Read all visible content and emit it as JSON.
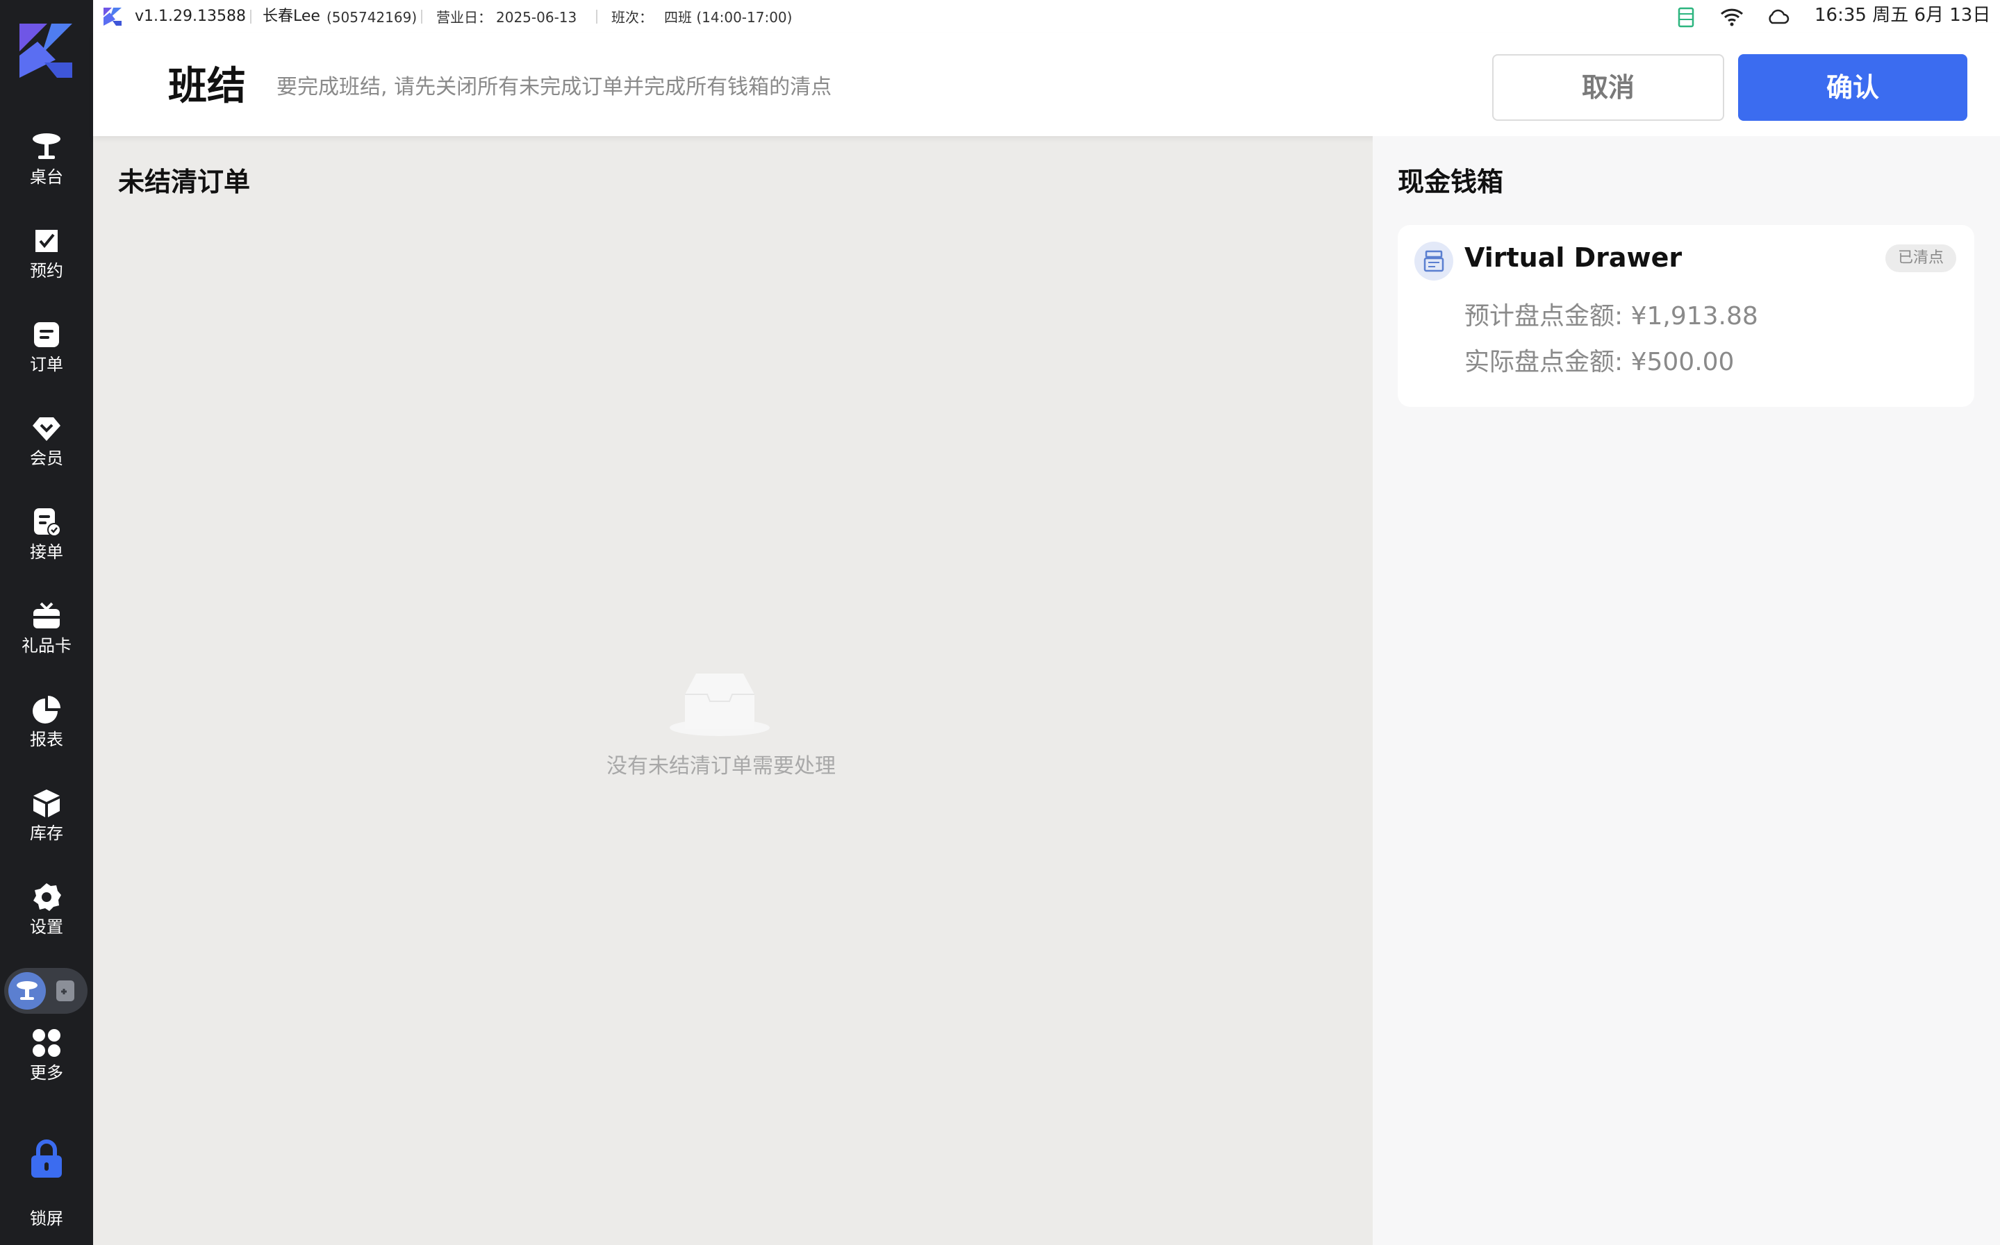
{
  "status_bar": {
    "version": "v1.1.29.13588",
    "user_name": "长春Lee",
    "user_id": "(505742169)",
    "business_day_label": "营业日：",
    "business_day": "2025-06-13",
    "shift_label": "班次：",
    "shift": "四班 (14:00-17:00)",
    "clock": "16:35 周五 6月 13日"
  },
  "sidebar": {
    "items": [
      {
        "label": "桌台",
        "icon": "table-icon"
      },
      {
        "label": "预约",
        "icon": "reservation-icon"
      },
      {
        "label": "订单",
        "icon": "order-icon"
      },
      {
        "label": "会员",
        "icon": "member-icon"
      },
      {
        "label": "接单",
        "icon": "accept-order-icon"
      },
      {
        "label": "礼品卡",
        "icon": "gift-card-icon"
      },
      {
        "label": "报表",
        "icon": "report-icon"
      },
      {
        "label": "库存",
        "icon": "inventory-icon"
      },
      {
        "label": "设置",
        "icon": "settings-icon"
      }
    ],
    "more_label": "更多",
    "lock_label": "锁屏"
  },
  "header": {
    "title": "班结",
    "description": "要完成班结, 请先关闭所有未完成订单并完成所有钱箱的清点",
    "cancel_label": "取消",
    "confirm_label": "确认"
  },
  "unsettled_orders": {
    "title": "未结清订单",
    "empty_text": "没有未结清订单需要处理"
  },
  "cash_drawer": {
    "title": "现金钱箱",
    "drawer": {
      "name": "Virtual Drawer",
      "status": "已清点",
      "expected_line": "预计盘点金额: ¥1,913.88",
      "actual_line": "实际盘点金额: ¥500.00"
    }
  },
  "colors": {
    "accent": "#3b6cf0",
    "sidebar_bg": "#1d1e21",
    "content_bg": "#ecebe9"
  }
}
